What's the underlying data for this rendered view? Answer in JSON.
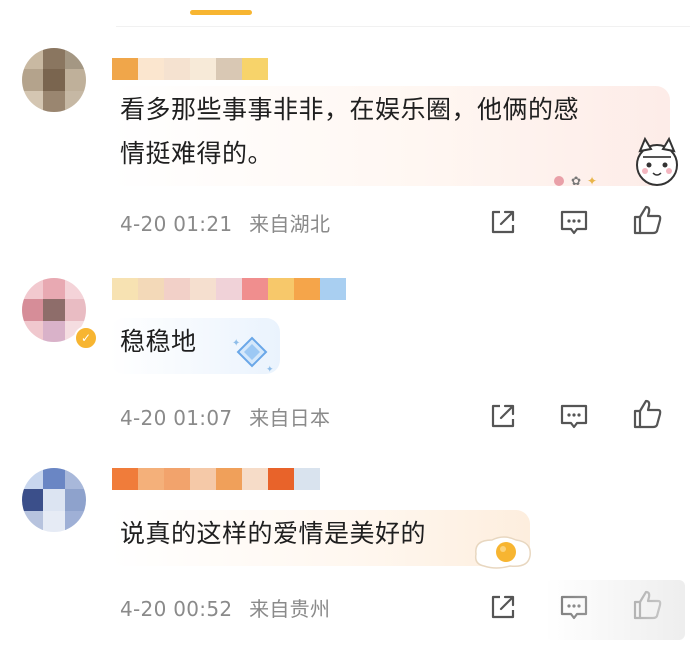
{
  "theme": {
    "accent": "#f7b531",
    "meta_color": "#8a8a8a",
    "text_color": "#1f1f1f"
  },
  "header": {
    "tab_indicator_color": "#f7b531"
  },
  "comments": [
    {
      "text_line1": "看多那些事事非非，在娱乐圈，他俩的感",
      "text_line2": "情挺难得的。",
      "time": "4-20 01:21",
      "location": "来自湖北",
      "decoration": "cat-sticker",
      "verified": false
    },
    {
      "text_line1": "稳稳地",
      "text_line2": "",
      "time": "4-20 01:07",
      "location": "来自日本",
      "decoration": "diamond-sticker",
      "verified": true
    },
    {
      "text_line1": "说真的这样的爱情是美好的",
      "text_line2": "",
      "time": "4-20 00:52",
      "location": "来自贵州",
      "decoration": "fried-egg-sticker",
      "verified": false
    }
  ],
  "actions": {
    "share_icon": "share-icon",
    "comment_icon": "comment-icon",
    "like_icon": "thumbs-up-icon"
  }
}
